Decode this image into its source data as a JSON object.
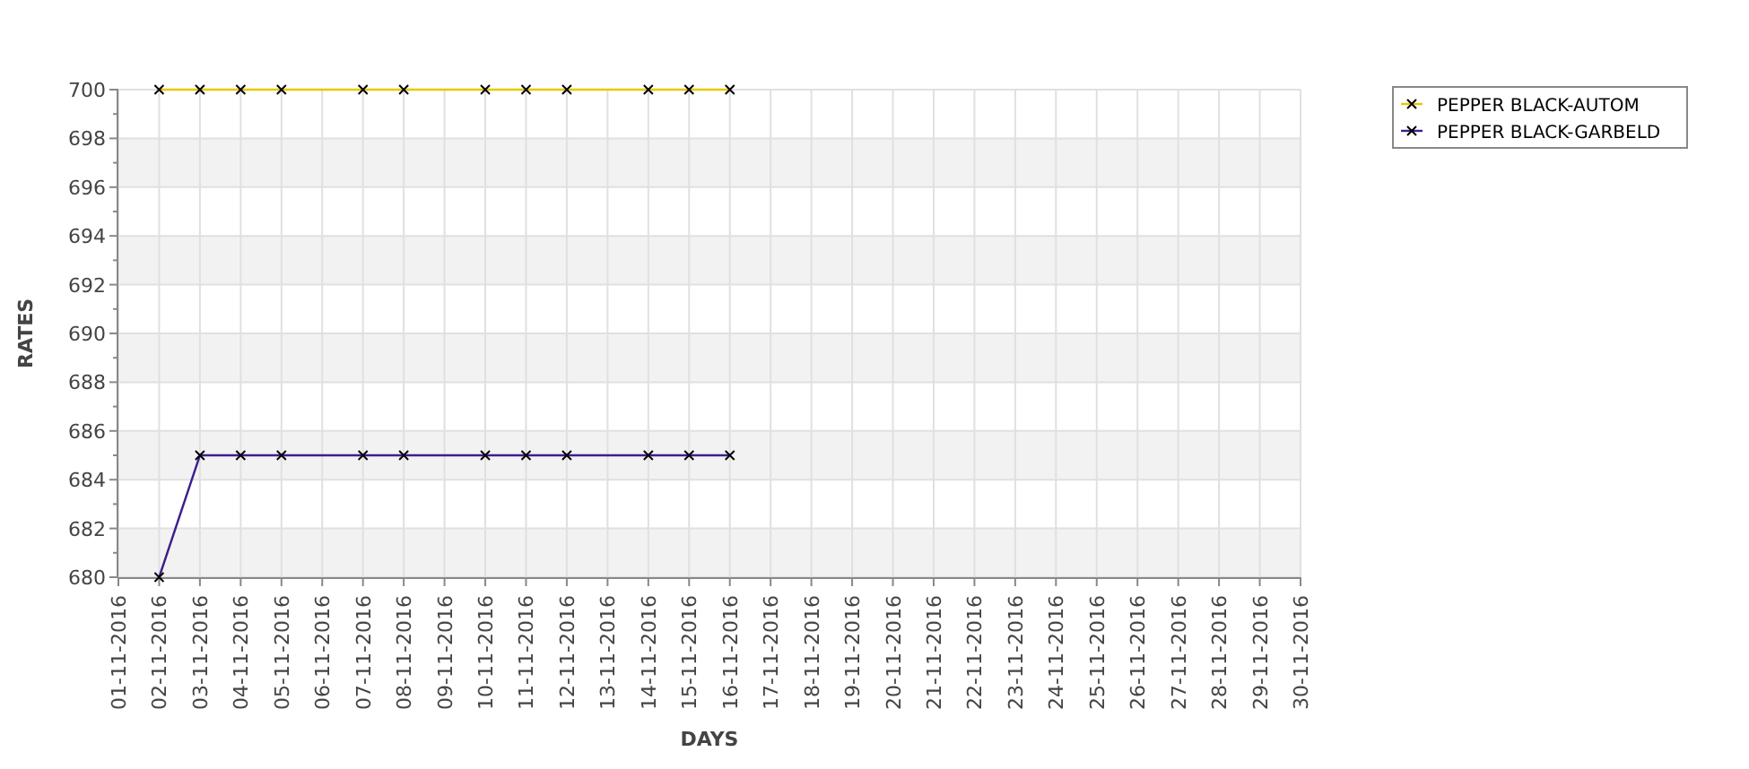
{
  "chart_data": {
    "type": "line",
    "xlabel": "DAYS",
    "ylabel": "RATES",
    "categories": [
      "01-11-2016",
      "02-11-2016",
      "03-11-2016",
      "04-11-2016",
      "05-11-2016",
      "06-11-2016",
      "07-11-2016",
      "08-11-2016",
      "09-11-2016",
      "10-11-2016",
      "11-11-2016",
      "12-11-2016",
      "13-11-2016",
      "14-11-2016",
      "15-11-2016",
      "16-11-2016",
      "17-11-2016",
      "18-11-2016",
      "19-11-2016",
      "20-11-2016",
      "21-11-2016",
      "22-11-2016",
      "23-11-2016",
      "24-11-2016",
      "25-11-2016",
      "26-11-2016",
      "27-11-2016",
      "28-11-2016",
      "29-11-2016",
      "30-11-2016"
    ],
    "series": [
      {
        "name": "PEPPER BLACK-AUTOM",
        "color": "#e6c800",
        "marker": "x",
        "values": [
          null,
          700,
          700,
          700,
          700,
          null,
          700,
          700,
          null,
          700,
          700,
          700,
          null,
          700,
          700,
          700,
          null,
          null,
          null,
          null,
          null,
          null,
          null,
          null,
          null,
          null,
          null,
          null,
          null,
          null
        ]
      },
      {
        "name": "PEPPER BLACK-GARBELD",
        "color": "#3c1f8c",
        "marker": "x",
        "values": [
          null,
          680,
          685,
          685,
          685,
          null,
          685,
          685,
          null,
          685,
          685,
          685,
          null,
          685,
          685,
          685,
          null,
          null,
          null,
          null,
          null,
          null,
          null,
          null,
          null,
          null,
          null,
          null,
          null,
          null
        ]
      }
    ],
    "grid": true,
    "legend": "right",
    "ylim": [
      680,
      700
    ],
    "yticks": [
      680,
      682,
      684,
      686,
      688,
      690,
      692,
      694,
      696,
      698,
      700
    ]
  }
}
